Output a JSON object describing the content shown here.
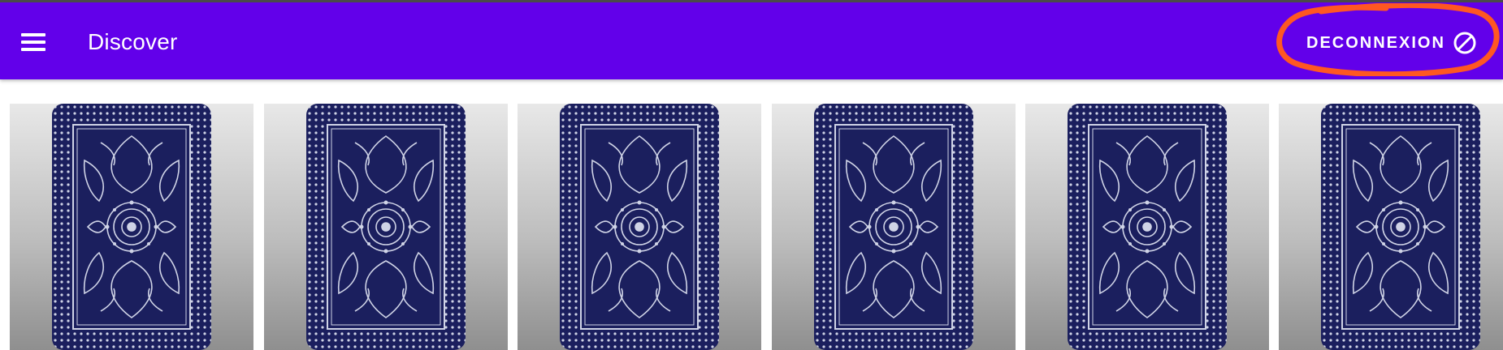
{
  "appbar": {
    "title": "Discover",
    "background_color": "#6200ea",
    "menu_icon": "hamburger-menu-icon",
    "logout_label": "DECONNEXION",
    "logout_icon": "block-icon",
    "highlight_color": "#ff5722"
  },
  "cards": {
    "count": 6,
    "card_back_color": "#1b1f5e",
    "card_pattern_color": "#cfd3e6",
    "items": [
      {
        "label": "card-back"
      },
      {
        "label": "card-back"
      },
      {
        "label": "card-back"
      },
      {
        "label": "card-back"
      },
      {
        "label": "card-back"
      },
      {
        "label": "card-back"
      }
    ]
  }
}
